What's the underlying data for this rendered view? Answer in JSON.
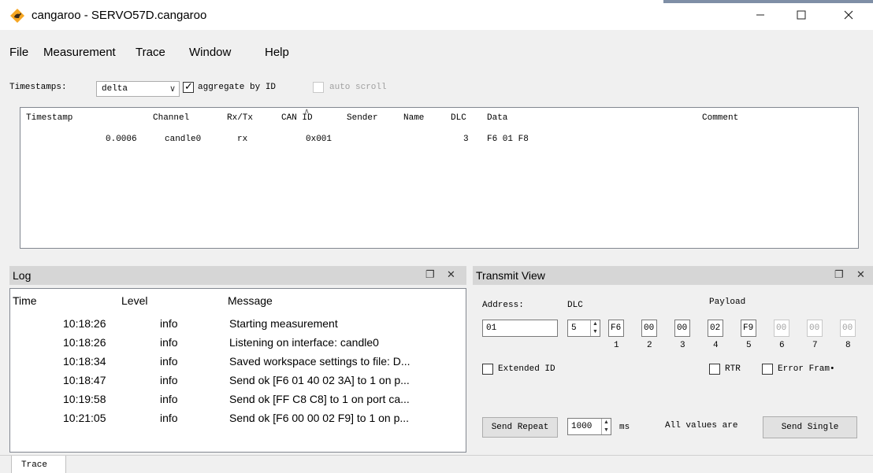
{
  "window": {
    "title": "cangaroo - SERVO57D.cangaroo",
    "app_icon": "kangaroo-logo-icon",
    "controls": [
      "minimize-icon",
      "maximize-icon",
      "close-icon"
    ],
    "colors": {
      "icon_orange": "#f5a623",
      "icon_dark": "#3b2a1a"
    }
  },
  "menu": {
    "items": [
      "File",
      "Measurement",
      "Trace",
      "Window",
      "Help"
    ]
  },
  "toolbar": {
    "timestamps_label": "Timestamps:",
    "timestamps_value": "delta",
    "aggregate_label": "aggregate by ID",
    "aggregate_checked": true,
    "autoscroll_label": "auto scroll",
    "autoscroll_checked": false
  },
  "trace": {
    "columns": [
      "Timestamp",
      "Channel",
      "Rx/Tx",
      "CAN ID",
      "Sender",
      "Name",
      "DLC",
      "Data",
      "Comment"
    ],
    "rows": [
      {
        "timestamp": "0.0006",
        "channel": "candle0",
        "rxtx": "rx",
        "can_id": "0x001",
        "sender": "",
        "name": "",
        "dlc": "3",
        "data": "F6 01 F8",
        "comment": ""
      }
    ]
  },
  "log": {
    "title": "Log",
    "columns": [
      "Time",
      "Level",
      "Message"
    ],
    "rows": [
      {
        "time": "10:18:26",
        "level": "info",
        "message": "Starting measurement"
      },
      {
        "time": "10:18:26",
        "level": "info",
        "message": "Listening on interface: candle0"
      },
      {
        "time": "10:18:34",
        "level": "info",
        "message": "Saved workspace settings to file: D..."
      },
      {
        "time": "10:18:47",
        "level": "info",
        "message": "Send ok [F6 01 40 02 3A] to 1 on p..."
      },
      {
        "time": "10:19:58",
        "level": "info",
        "message": "Send ok [FF C8 C8] to 1 on port ca..."
      },
      {
        "time": "10:21:05",
        "level": "info",
        "message": "Send ok [F6 00 00 02 F9] to 1 on p..."
      }
    ]
  },
  "transmit": {
    "title": "Transmit View",
    "address_label": "Address:",
    "dlc_label": "DLC",
    "payload_label": "Payload",
    "address_value": "01",
    "dlc_value": "5",
    "payload": [
      "F6",
      "00",
      "00",
      "02",
      "F9",
      "00",
      "00",
      "00"
    ],
    "payload_indices": [
      "1",
      "2",
      "3",
      "4",
      "5",
      "6",
      "7",
      "8"
    ],
    "extended_id_label": "Extended ID",
    "rtr_label": "RTR",
    "error_frame_label": "Error Fram•",
    "send_repeat_label": "Send Repeat",
    "interval_value": "1000",
    "interval_unit": "ms",
    "hint_text": "All values are",
    "send_single_label": "Send Single"
  },
  "tabs": {
    "items": [
      "Trace"
    ]
  },
  "panel_icons": [
    "float-icon",
    "close-icon"
  ]
}
